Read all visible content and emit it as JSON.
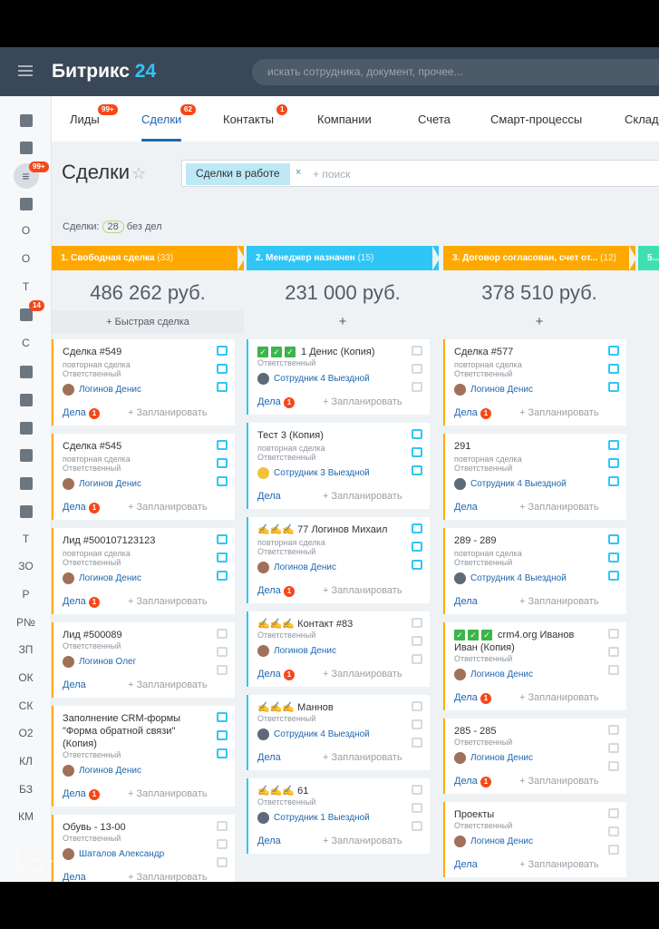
{
  "header": {
    "logo_text": "Битрикс",
    "logo_num": "24",
    "search_placeholder": "искать сотрудника, документ, прочее..."
  },
  "rail": {
    "letters": [
      "О",
      "О",
      "Т",
      "С",
      "Т",
      "ЗО",
      "Р",
      "Р№",
      "ЗП",
      "ОК",
      "СК",
      "О2",
      "КЛ",
      "БЗ",
      "КМ"
    ],
    "badges": [
      "99+",
      "14"
    ]
  },
  "tabs": [
    {
      "label": "Лиды",
      "badge": "99+"
    },
    {
      "label": "Сделки",
      "badge": "62"
    },
    {
      "label": "Контакты",
      "badge": "1"
    },
    {
      "label": "Компании"
    },
    {
      "label": "Счета"
    },
    {
      "label": "Смарт-процессы"
    },
    {
      "label": "Склад"
    }
  ],
  "page": {
    "title": "Сделки",
    "filter_chip": "Сделки в работе",
    "filter_close": "×",
    "filter_placeholder": "+ поиск",
    "count_label": "Сделки:",
    "count": "28",
    "count_suffix": "без дел"
  },
  "labels": {
    "resp": "Ответственный",
    "repeat": "повторная сделка",
    "acts": "Дела",
    "plan": "+ Запланировать"
  },
  "columns": [
    {
      "stage": "1. Свободная сделка",
      "count": "(33)",
      "color": "#ffa900",
      "sum": "486 262 руб.",
      "quick": "+ Быстрая сделка",
      "cards": [
        {
          "title": "Сделка #549",
          "repeat": true,
          "user": "Логинов Денис",
          "badge": "1"
        },
        {
          "title": "Сделка #545",
          "repeat": true,
          "user": "Логинов Денис",
          "badge": "1"
        },
        {
          "title": "Лид #500107123123",
          "repeat": true,
          "user": "Логинов Денис",
          "badge": "1"
        },
        {
          "title": "Лид #500089",
          "repeat": false,
          "user": "Логинов Олег",
          "badge": ""
        },
        {
          "title": "Заполнение CRM-формы \"Форма обратной связи\" (Копия)",
          "repeat": false,
          "user": "Логинов Денис",
          "badge": "1"
        },
        {
          "title": "Обувь - 13-00",
          "repeat": false,
          "user": "Шаталов Александр",
          "badge": ""
        }
      ]
    },
    {
      "stage": "2. Менеджер назначен",
      "count": "(15)",
      "color": "#2fc6f6",
      "sum": "231 000 руб.",
      "quick": "+",
      "cards": [
        {
          "title": "1 Денис (Копия)",
          "checks": 3,
          "repeat": false,
          "user": "Сотрудник 4 Выездной",
          "badge": "1"
        },
        {
          "title": "Тест 3 (Копия)",
          "repeat": true,
          "user": "Сотрудник 3 Выездной",
          "badge": ""
        },
        {
          "title": "77 Логинов Михаил",
          "hands": 3,
          "repeat": true,
          "user": "Логинов Денис",
          "badge": "1"
        },
        {
          "title": "Контакт #83",
          "hands": 3,
          "repeat": false,
          "user": "Логинов Денис",
          "badge": "1"
        },
        {
          "title": "Маннов",
          "hands": 3,
          "repeat": false,
          "user": "Сотрудник 4 Выездной",
          "badge": ""
        },
        {
          "title": "61",
          "hands": 3,
          "repeat": false,
          "user": "Сотрудник 1 Выездной",
          "badge": ""
        }
      ]
    },
    {
      "stage": "3. Договор согласован, счет от...",
      "count": "(12)",
      "color": "#ffa900",
      "sum": "378 510 руб.",
      "quick": "+",
      "cards": [
        {
          "title": "Сделка #577",
          "repeat": true,
          "user": "Логинов Денис",
          "badge": "1"
        },
        {
          "title": "291",
          "repeat": true,
          "user": "Сотрудник 4 Выездной",
          "badge": ""
        },
        {
          "title": "289 - 289",
          "repeat": true,
          "user": "Сотрудник 4 Выездной",
          "badge": ""
        },
        {
          "title": "crm4.org Иванов Иван (Копия)",
          "checks": 3,
          "repeat": false,
          "user": "Логинов Денис",
          "badge": "1"
        },
        {
          "title": "285 - 285",
          "repeat": false,
          "user": "Логинов Денис",
          "badge": "1"
        },
        {
          "title": "Проекты",
          "repeat": false,
          "user": "Логинов Денис",
          "badge": ""
        }
      ]
    },
    {
      "stage": "5...",
      "count": "",
      "color": "#3fe0b0",
      "sum": "",
      "quick": "",
      "cards": []
    }
  ],
  "watermark": "18+"
}
